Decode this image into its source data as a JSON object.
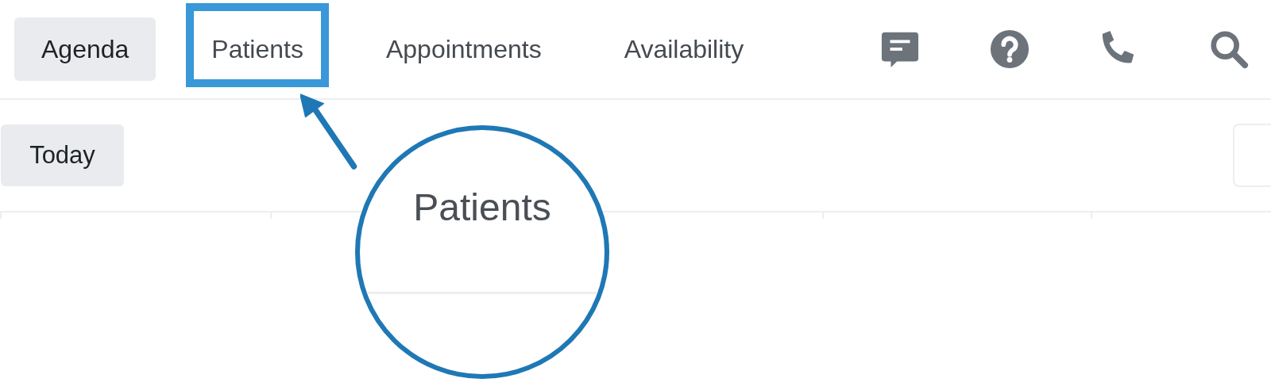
{
  "nav": {
    "tabs": [
      {
        "label": "Agenda",
        "selected": true,
        "highlighted": false
      },
      {
        "label": "Patients",
        "selected": false,
        "highlighted": true
      },
      {
        "label": "Appointments",
        "selected": false,
        "highlighted": false
      },
      {
        "label": "Availability",
        "selected": false,
        "highlighted": false
      }
    ],
    "icons": [
      {
        "kind": "chat"
      },
      {
        "kind": "help"
      },
      {
        "kind": "phone"
      },
      {
        "kind": "search"
      }
    ]
  },
  "toolbar": {
    "today_button": "Today"
  },
  "callout": {
    "text": "Patients"
  }
}
